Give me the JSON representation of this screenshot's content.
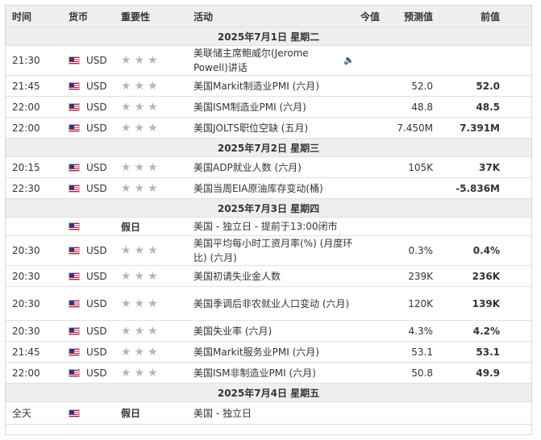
{
  "header": {
    "time": "时间",
    "currency": "货币",
    "importance": "重要性",
    "event": "活动",
    "actual": "今值",
    "forecast": "预测值",
    "previous": "前值"
  },
  "star": "★",
  "speaker_icon": "🔈",
  "rows": [
    {
      "type": "date",
      "text": "2025年7月1日  星期二"
    },
    {
      "type": "event",
      "time": "21:30",
      "currency": "USD",
      "event": "美联储主席鲍威尔(Jerome Powell)讲话",
      "actual": "",
      "forecast": "",
      "previous": ""
    },
    {
      "type": "event",
      "time": "21:45",
      "currency": "USD",
      "event": "美国Markit制造业PMI (六月)",
      "actual": "",
      "forecast": "52.0",
      "previous": "52.0"
    },
    {
      "type": "event",
      "time": "22:00",
      "currency": "USD",
      "event": "美国ISM制造业PMI (六月)",
      "actual": "",
      "forecast": "48.8",
      "previous": "48.5"
    },
    {
      "type": "event",
      "time": "22:00",
      "currency": "USD",
      "event": "美国JOLTS职位空缺 (五月)",
      "actual": "",
      "forecast": "7.450M",
      "previous": "7.391M"
    },
    {
      "type": "date",
      "text": "2025年7月2日  星期三"
    },
    {
      "type": "event",
      "time": "20:15",
      "currency": "USD",
      "event": "美国ADP就业人数 (六月)",
      "actual": "",
      "forecast": "105K",
      "previous": "37K"
    },
    {
      "type": "event",
      "time": "22:30",
      "currency": "USD",
      "event": "美国当周EIA原油库存变动(桶)",
      "actual": "",
      "forecast": "",
      "previous": "-5.836M"
    },
    {
      "type": "date",
      "text": "2025年7月3日  星期四"
    },
    {
      "type": "holiday",
      "time": "",
      "label": "假日",
      "event": "美国 - 独立日 - 提前于13:00闭市"
    },
    {
      "type": "event",
      "time": "20:30",
      "currency": "USD",
      "event": "美国平均每小时工资月率(%) (月度环比) (六月)",
      "actual": "",
      "forecast": "0.3%",
      "previous": "0.4%"
    },
    {
      "type": "event",
      "time": "20:30",
      "currency": "USD",
      "event": "美国初请失业金人数",
      "actual": "",
      "forecast": "239K",
      "previous": "236K"
    },
    {
      "type": "event",
      "time": "20:30",
      "currency": "USD",
      "event": "美国季调后非农就业人口变动 (六月)",
      "actual": "",
      "forecast": "120K",
      "previous": "139K"
    },
    {
      "type": "event",
      "time": "20:30",
      "currency": "USD",
      "event": "美国失业率 (六月)",
      "actual": "",
      "forecast": "4.3%",
      "previous": "4.2%"
    },
    {
      "type": "event",
      "time": "21:45",
      "currency": "USD",
      "event": "美国Markit服务业PMI (六月)",
      "actual": "",
      "forecast": "53.1",
      "previous": "53.1"
    },
    {
      "type": "event",
      "time": "22:00",
      "currency": "USD",
      "event": "美国ISM非制造业PMI (六月)",
      "actual": "",
      "forecast": "50.8",
      "previous": "49.9"
    },
    {
      "type": "date",
      "text": "2025年7月4日  星期五"
    },
    {
      "type": "holiday",
      "time": "全天",
      "label": "假日",
      "event": "美国 - 独立日"
    }
  ]
}
